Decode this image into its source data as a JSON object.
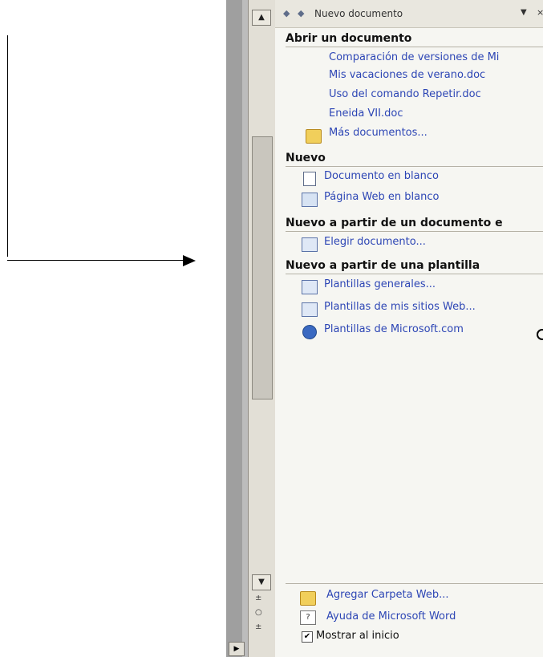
{
  "task_pane": {
    "title": "Nuevo documento",
    "sections": {
      "open": {
        "heading": "Abrir un documento",
        "items": [
          "Comparación de versiones de Mi",
          "Mis vacaciones de verano.doc",
          "Uso del comando Repetir.doc",
          "Eneida VII.doc"
        ],
        "more": "Más documentos..."
      },
      "new": {
        "heading": "Nuevo",
        "items": [
          "Documento en blanco",
          "Página Web en blanco"
        ]
      },
      "from_existing": {
        "heading": "Nuevo a partir de un documento e",
        "items": [
          "Elegir documento..."
        ]
      },
      "from_template": {
        "heading": "Nuevo a partir de una plantilla",
        "items": [
          "Plantillas generales...",
          "Plantillas de mis sitios Web...",
          "Plantillas de Microsoft.com"
        ]
      }
    },
    "footer": {
      "add_web_folder": "Agregar Carpeta Web...",
      "help": "Ayuda de Microsoft Word",
      "show_at_startup": "Mostrar al inicio",
      "show_at_startup_checked": true
    }
  },
  "icons": {
    "back": "back-arrow-icon",
    "forward": "forward-arrow-icon",
    "menu": "dropdown-arrow-icon",
    "close": "close-icon",
    "folder": "folder-icon",
    "blank_doc": "blank-document-icon",
    "web_page": "web-page-icon",
    "template": "template-icon",
    "globe": "globe-icon",
    "help": "help-icon"
  }
}
